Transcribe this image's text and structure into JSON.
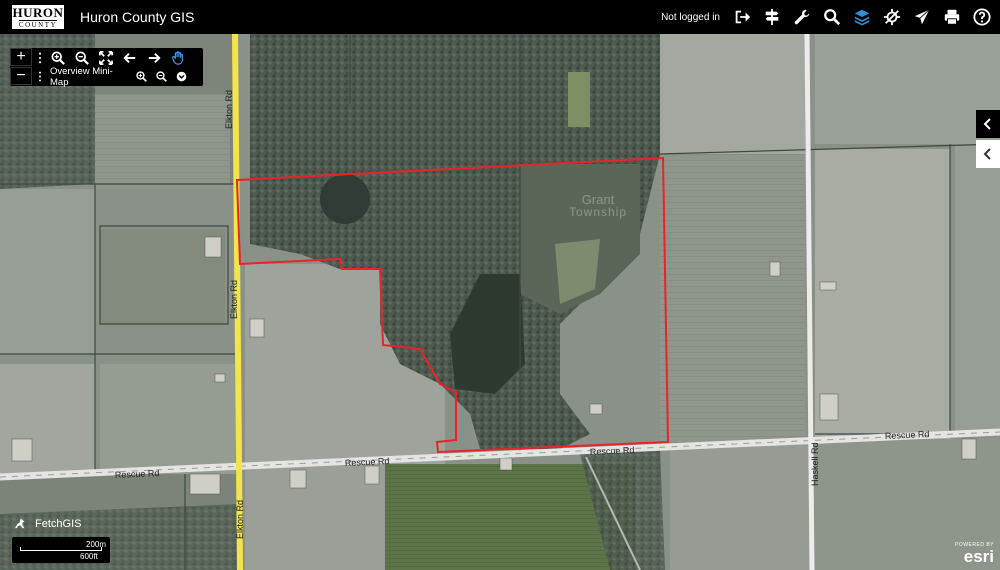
{
  "header": {
    "logo_top": "HURON",
    "logo_bottom": "COUNTY",
    "title": "Huron County GIS",
    "login_status": "Not logged in"
  },
  "toolbar": {
    "icons": [
      "login-icon",
      "directions-icon",
      "tools-icon",
      "search-icon",
      "layers-icon",
      "gps-icon",
      "share-icon",
      "print-icon",
      "help-icon"
    ],
    "layers_color": "#2f8fd8"
  },
  "map_controls": {
    "zoom_in": "+",
    "zoom_out": "−",
    "minimap_label": "Overview Mini-Map"
  },
  "map_labels": {
    "township_line1": "Grant",
    "township_line2": "Township",
    "road_elkton_top": "Elkton Rd",
    "road_elkton_mid": "Elkton Rd",
    "road_elkton_bottom": "Elkton Rd",
    "road_rescue_left": "Rescue Rd",
    "road_rescue_mid": "Rescue Rd",
    "road_rescue_center": "Rescue Rd",
    "road_rescue_right": "Rescue Rd",
    "road_hellems": "Haskell Rd"
  },
  "footer": {
    "fetchgis_label": "FetchGIS",
    "scale_metric": "200m",
    "scale_imperial": "600ft",
    "esri_powered": "POWERED BY",
    "esri_name": "esri"
  },
  "colors": {
    "parcel_outline": "#e8232a",
    "road_yellow": "#f3e44a",
    "road_white": "#f2f2f2",
    "accent": "#2f8fd8"
  }
}
